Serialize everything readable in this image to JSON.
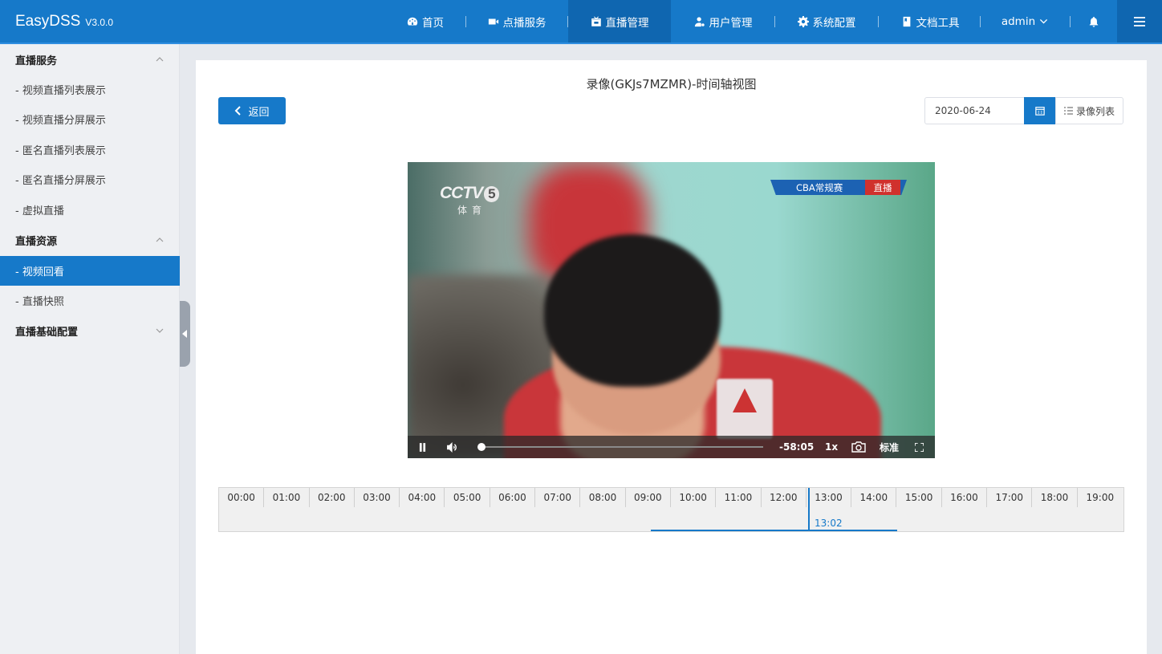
{
  "header": {
    "brand": "EasyDSS",
    "version": "V3.0.0",
    "nav": [
      {
        "label": "首页",
        "icon": "dashboard-icon"
      },
      {
        "label": "点播服务",
        "icon": "video-camera-icon"
      },
      {
        "label": "直播管理",
        "icon": "live-tv-icon",
        "active": true
      },
      {
        "label": "用户管理",
        "icon": "user-gear-icon"
      },
      {
        "label": "系统配置",
        "icon": "gear-icon"
      },
      {
        "label": "文档工具",
        "icon": "book-icon"
      }
    ],
    "user": "admin"
  },
  "sidebar": {
    "groups": [
      {
        "label": "直播服务",
        "items": [
          "- 视频直播列表展示",
          "- 视频直播分屏展示",
          "- 匿名直播列表展示",
          "- 匿名直播分屏展示",
          "- 虚拟直播"
        ]
      },
      {
        "label": "直播资源",
        "items": [
          "- 视频回看",
          "- 直播快照"
        ]
      },
      {
        "label": "直播基础配置",
        "items": []
      }
    ],
    "active_item": "- 视频回看"
  },
  "main": {
    "title": "录像(GKJs7MZMR)-时间轴视图",
    "back_label": "返回",
    "date": "2020-06-24",
    "list_label": "录像列表"
  },
  "video": {
    "channel_logo": "CCTV",
    "channel_number": "5",
    "channel_sub": "体育",
    "overlay_event": "CBA常规赛",
    "overlay_live": "直播",
    "time_remaining": "-58:05",
    "speed": "1x",
    "quality": "标准",
    "progress": 0.02
  },
  "timeline": {
    "ticks": [
      "00:00",
      "01:00",
      "02:00",
      "03:00",
      "04:00",
      "05:00",
      "06:00",
      "07:00",
      "08:00",
      "09:00",
      "10:00",
      "11:00",
      "12:00",
      "13:00",
      "14:00",
      "15:00",
      "16:00",
      "17:00",
      "18:00",
      "19:00"
    ],
    "current": "13:02"
  }
}
